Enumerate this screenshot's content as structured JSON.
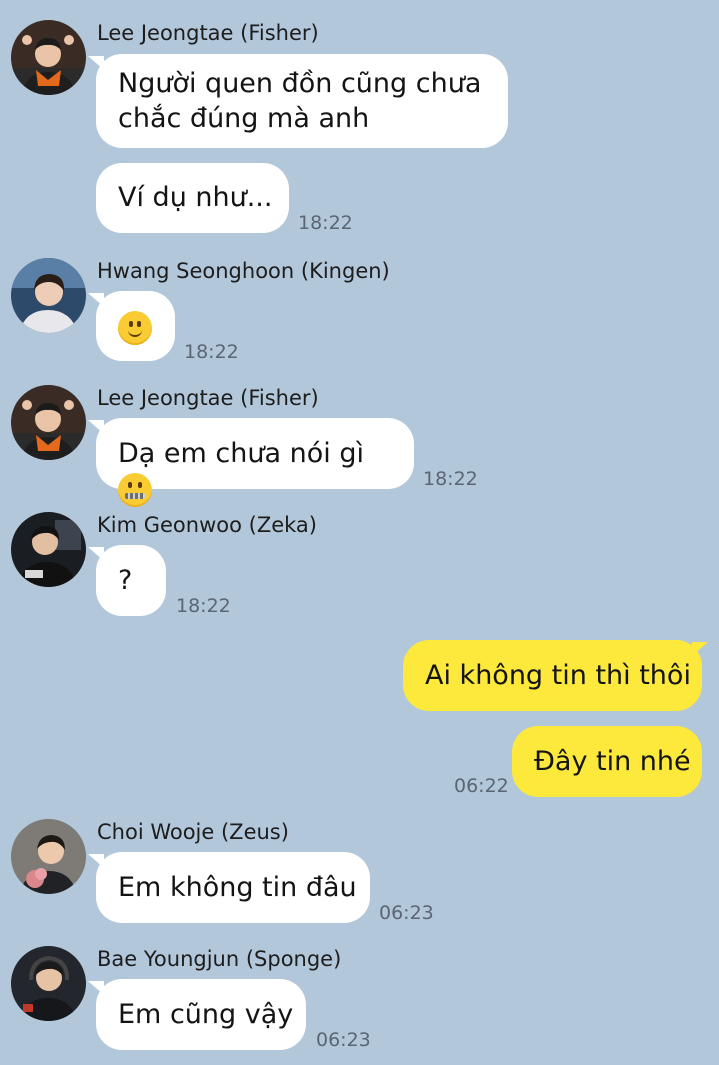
{
  "messages": [
    {
      "sender": "Lee Jeongtae (Fisher)",
      "lines": [
        "Người quen đồn cũng chưa",
        "chắc đúng mà anh"
      ]
    },
    {
      "sender": "Lee Jeongtae (Fisher)",
      "lines": [
        "Ví dụ như..."
      ],
      "time": "18:22"
    },
    {
      "sender": "Hwang Seonghoon (Kingen)",
      "emoji": "slightly-smiling-face-icon",
      "time": "18:22"
    },
    {
      "sender": "Lee Jeongtae (Fisher)",
      "lines": [
        "Dạ em chưa nói gì"
      ],
      "emoji": "zipper-mouth-face-icon",
      "time": "18:22"
    },
    {
      "sender": "Kim Geonwoo (Zeka)",
      "lines": [
        "?"
      ],
      "time": "18:22"
    },
    {
      "sender": "me",
      "lines": [
        "Ai không tin thì thôi"
      ]
    },
    {
      "sender": "me",
      "lines": [
        "Đây tin nhé"
      ],
      "time": "06:22"
    },
    {
      "sender": "Choi Wooje (Zeus)",
      "lines": [
        "Em không tin đâu"
      ],
      "time": "06:23"
    },
    {
      "sender": "Bae Youngjun (Sponge)",
      "lines": [
        "Em cũng vậy"
      ],
      "time": "06:23"
    }
  ],
  "colors": {
    "background": "#b2c7da",
    "incoming_bubble": "#ffffff",
    "outgoing_bubble": "#fde83c",
    "timestamp": "#5a6674"
  }
}
